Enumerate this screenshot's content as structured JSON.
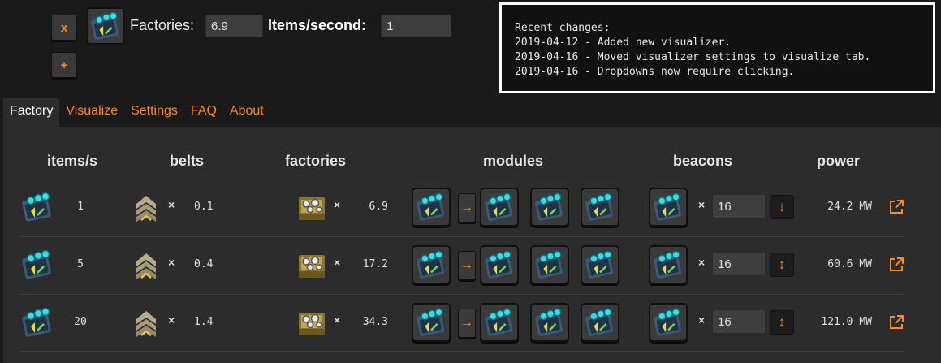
{
  "top": {
    "remove_label": "x",
    "add_label": "+",
    "factories_label": "Factories:",
    "factories_value": "6.9",
    "items_label": "Items/second:",
    "items_value": "1"
  },
  "changes": {
    "title": "Recent changes:",
    "lines": [
      "2019-04-12 - Added new visualizer.",
      "2019-04-16 - Moved visualizer settings to visualize tab.",
      "2019-04-16 - Dropdowns now require clicking."
    ]
  },
  "tabs": [
    "Factory",
    "Visualize",
    "Settings",
    "FAQ",
    "About"
  ],
  "active_tab": "Factory",
  "headers": {
    "items": "items/s",
    "belts": "belts",
    "factories": "factories",
    "modules": "modules",
    "beacons": "beacons",
    "power": "power"
  },
  "times": "×",
  "rows": [
    {
      "items": "1",
      "belts": "0.1",
      "factories": "6.9",
      "beacon_count": "16",
      "beacon_dir": "↓",
      "power": "24.2 MW"
    },
    {
      "items": "5",
      "belts": "0.4",
      "factories": "17.2",
      "beacon_count": "16",
      "beacon_dir": "↕",
      "power": "60.6 MW"
    },
    {
      "items": "20",
      "belts": "1.4",
      "factories": "34.3",
      "beacon_count": "16",
      "beacon_dir": "↕",
      "power": "121.0 MW"
    }
  ],
  "module_arrow": "→",
  "icons": {
    "recipe": "module-circuit-icon",
    "belt": "belt-icon",
    "factory": "assembler-icon",
    "module": "module-circuit-icon",
    "beacon": "beacon-module-icon",
    "external": "external-link-icon"
  },
  "colors": {
    "accent": "#ff8a1e",
    "panel": "#2c2c2c",
    "background": "#1a1a1a"
  }
}
